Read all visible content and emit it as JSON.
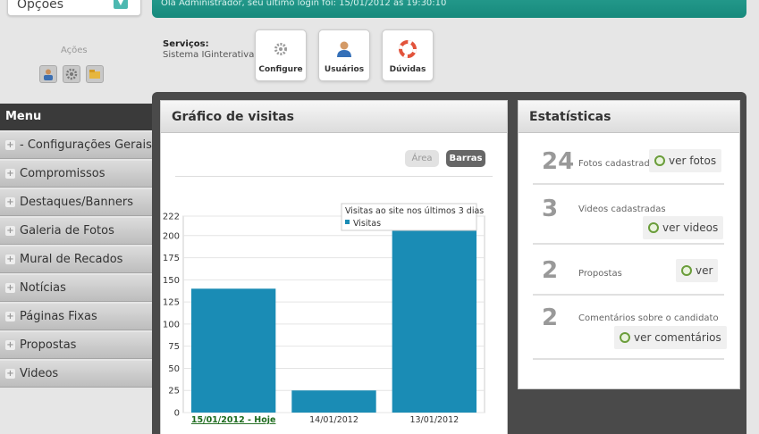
{
  "header": {
    "options_label": "Opções",
    "welcome": "Olá Administrador, seu último login foi: 15/01/2012 às 19:30:10"
  },
  "acoes": {
    "title": "Ações"
  },
  "servicos": {
    "title": "Serviços:",
    "subtitle": "Sistema IGinterativa",
    "buttons": [
      {
        "label": "Configure",
        "icon": "gear-icon"
      },
      {
        "label": "Usuários",
        "icon": "user-icon"
      },
      {
        "label": "Dúvidas",
        "icon": "lifebuoy-icon"
      }
    ]
  },
  "menu": {
    "title": "Menu",
    "items": [
      "- Configurações Gerais",
      "Compromissos",
      "Destaques/Banners",
      "Galeria de Fotos",
      "Mural de Recados",
      "Notícias",
      "Páginas Fixas",
      "Propostas",
      "Videos"
    ]
  },
  "grafico": {
    "title": "Gráfico de visitas",
    "toggle_area": "Área",
    "toggle_barras": "Barras"
  },
  "chart_data": {
    "type": "bar",
    "title": "Visitas ao site nos últimos 3 dias",
    "categories": [
      "15/01/2012 - Hoje",
      "14/01/2012",
      "13/01/2012"
    ],
    "series": [
      {
        "name": "Visitas",
        "values": [
          140,
          25,
          210
        ]
      }
    ],
    "yticks": [
      0,
      25,
      50,
      75,
      100,
      125,
      150,
      175,
      200,
      222
    ],
    "ylim": [
      0,
      222
    ],
    "bar_color": "#1a8cb5"
  },
  "estatisticas": {
    "title": "Estatísticas",
    "rows": [
      {
        "count": "24",
        "label": "Fotos cadastradas",
        "link": "ver fotos"
      },
      {
        "count": "3",
        "label": "Videos cadastradas",
        "link": "ver videos"
      },
      {
        "count": "2",
        "label": "Propostas",
        "link": "ver"
      },
      {
        "count": "2",
        "label": "Comentários sobre o candidato",
        "link": "ver comentários"
      }
    ]
  }
}
